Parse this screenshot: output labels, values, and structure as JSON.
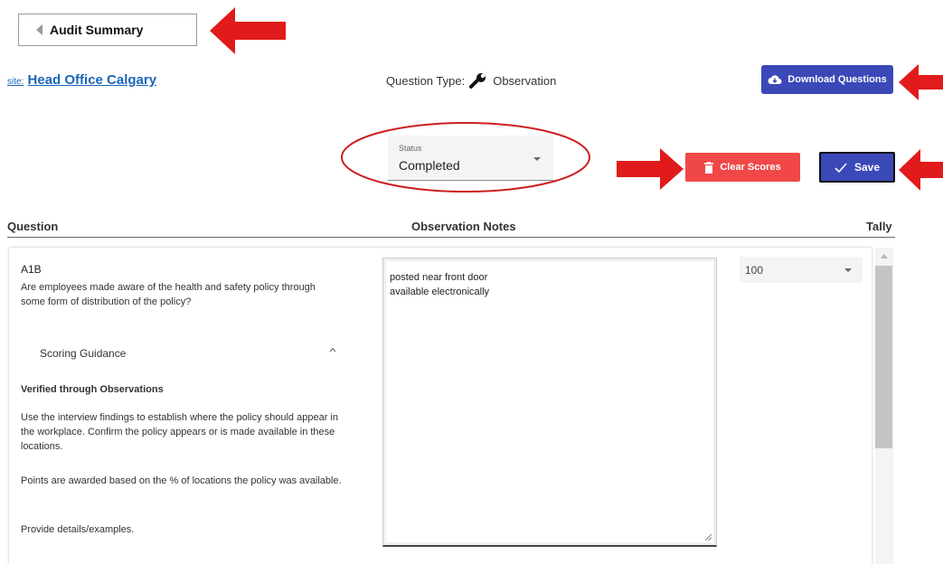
{
  "header": {
    "back_label": "Audit Summary"
  },
  "site": {
    "prefix": "site:",
    "name": "Head Office Calgary"
  },
  "question_type": {
    "label": "Question Type:",
    "value": "Observation",
    "icon": "wrench-icon"
  },
  "toolbar": {
    "download_label": "Download Questions",
    "clear_label": "Clear Scores",
    "save_label": "Save"
  },
  "status": {
    "label": "Status",
    "value": "Completed"
  },
  "table_headers": {
    "question": "Question",
    "notes": "Observation Notes",
    "tally": "Tally"
  },
  "question": {
    "id": "A1B",
    "text": "Are employees made aware of the health and safety policy through some form of distribution of the policy?",
    "scoring_guidance_label": "Scoring Guidance",
    "guidance": {
      "heading": "Verified through Observations",
      "p1": "Use the interview findings to establish where the policy should appear in the workplace. Confirm the policy appears or is made available in these locations.",
      "p2": "Points are awarded based on the % of locations the policy was available.",
      "p3": "Provide details/examples."
    },
    "notes": "posted near front door\navailable electronically",
    "tally": "100"
  },
  "colors": {
    "primary": "#3b48b8",
    "danger": "#f04848",
    "link": "#1a66b8",
    "annotation": "#e11b1b"
  }
}
